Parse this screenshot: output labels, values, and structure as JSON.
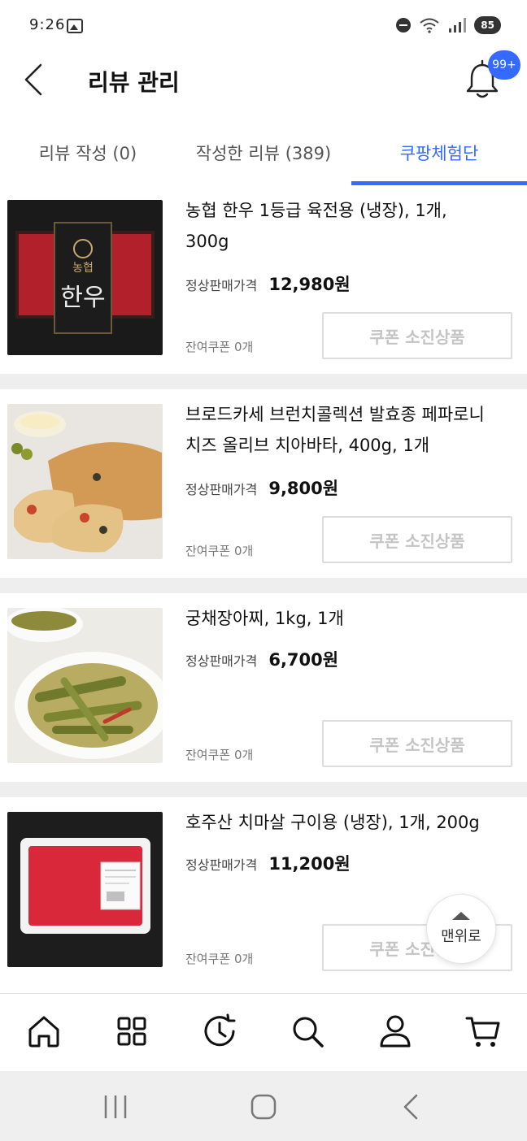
{
  "status_bar": {
    "time": "9:26",
    "battery": "85",
    "icons": [
      "image-icon",
      "dnd-icon",
      "wifi-icon",
      "signal-icon",
      "battery-icon"
    ]
  },
  "header": {
    "title": "리뷰 관리",
    "notification_badge": "99+",
    "icons": [
      "back-arrow-icon",
      "bell-icon"
    ]
  },
  "tabs": [
    {
      "label": "리뷰 작성 (0)",
      "active": false
    },
    {
      "label": "작성한 리뷰 (389)",
      "active": false
    },
    {
      "label": "쿠팡체험단",
      "active": true
    }
  ],
  "price_label": "정상판매가격",
  "coupon_left_label": "잔여쿠폰 0개",
  "coupon_button_label": "쿠폰 소진상품",
  "products": [
    {
      "name_line1": "농협 한우 1등급 육전용 (냉장), 1개,",
      "name_line2": "300g",
      "price": "12,980원"
    },
    {
      "name_line1": "브로드카세 브런치콜렉션 발효종 페파로니",
      "name_line2": "치즈 올리브 치아바타, 400g, 1개",
      "price": "9,800원"
    },
    {
      "name_line1": "궁채장아찌, 1kg, 1개",
      "name_line2": "",
      "price": "6,700원"
    },
    {
      "name_line1": "호주산 치마살 구이용 (냉장), 1개, 200g",
      "name_line2": "",
      "price": "11,200원"
    }
  ],
  "top_button_label": "맨위로",
  "bottom_nav": [
    "home-icon",
    "category-grid-icon",
    "recent-history-icon",
    "search-icon",
    "account-icon",
    "cart-icon"
  ],
  "accent_color": "#346aff"
}
